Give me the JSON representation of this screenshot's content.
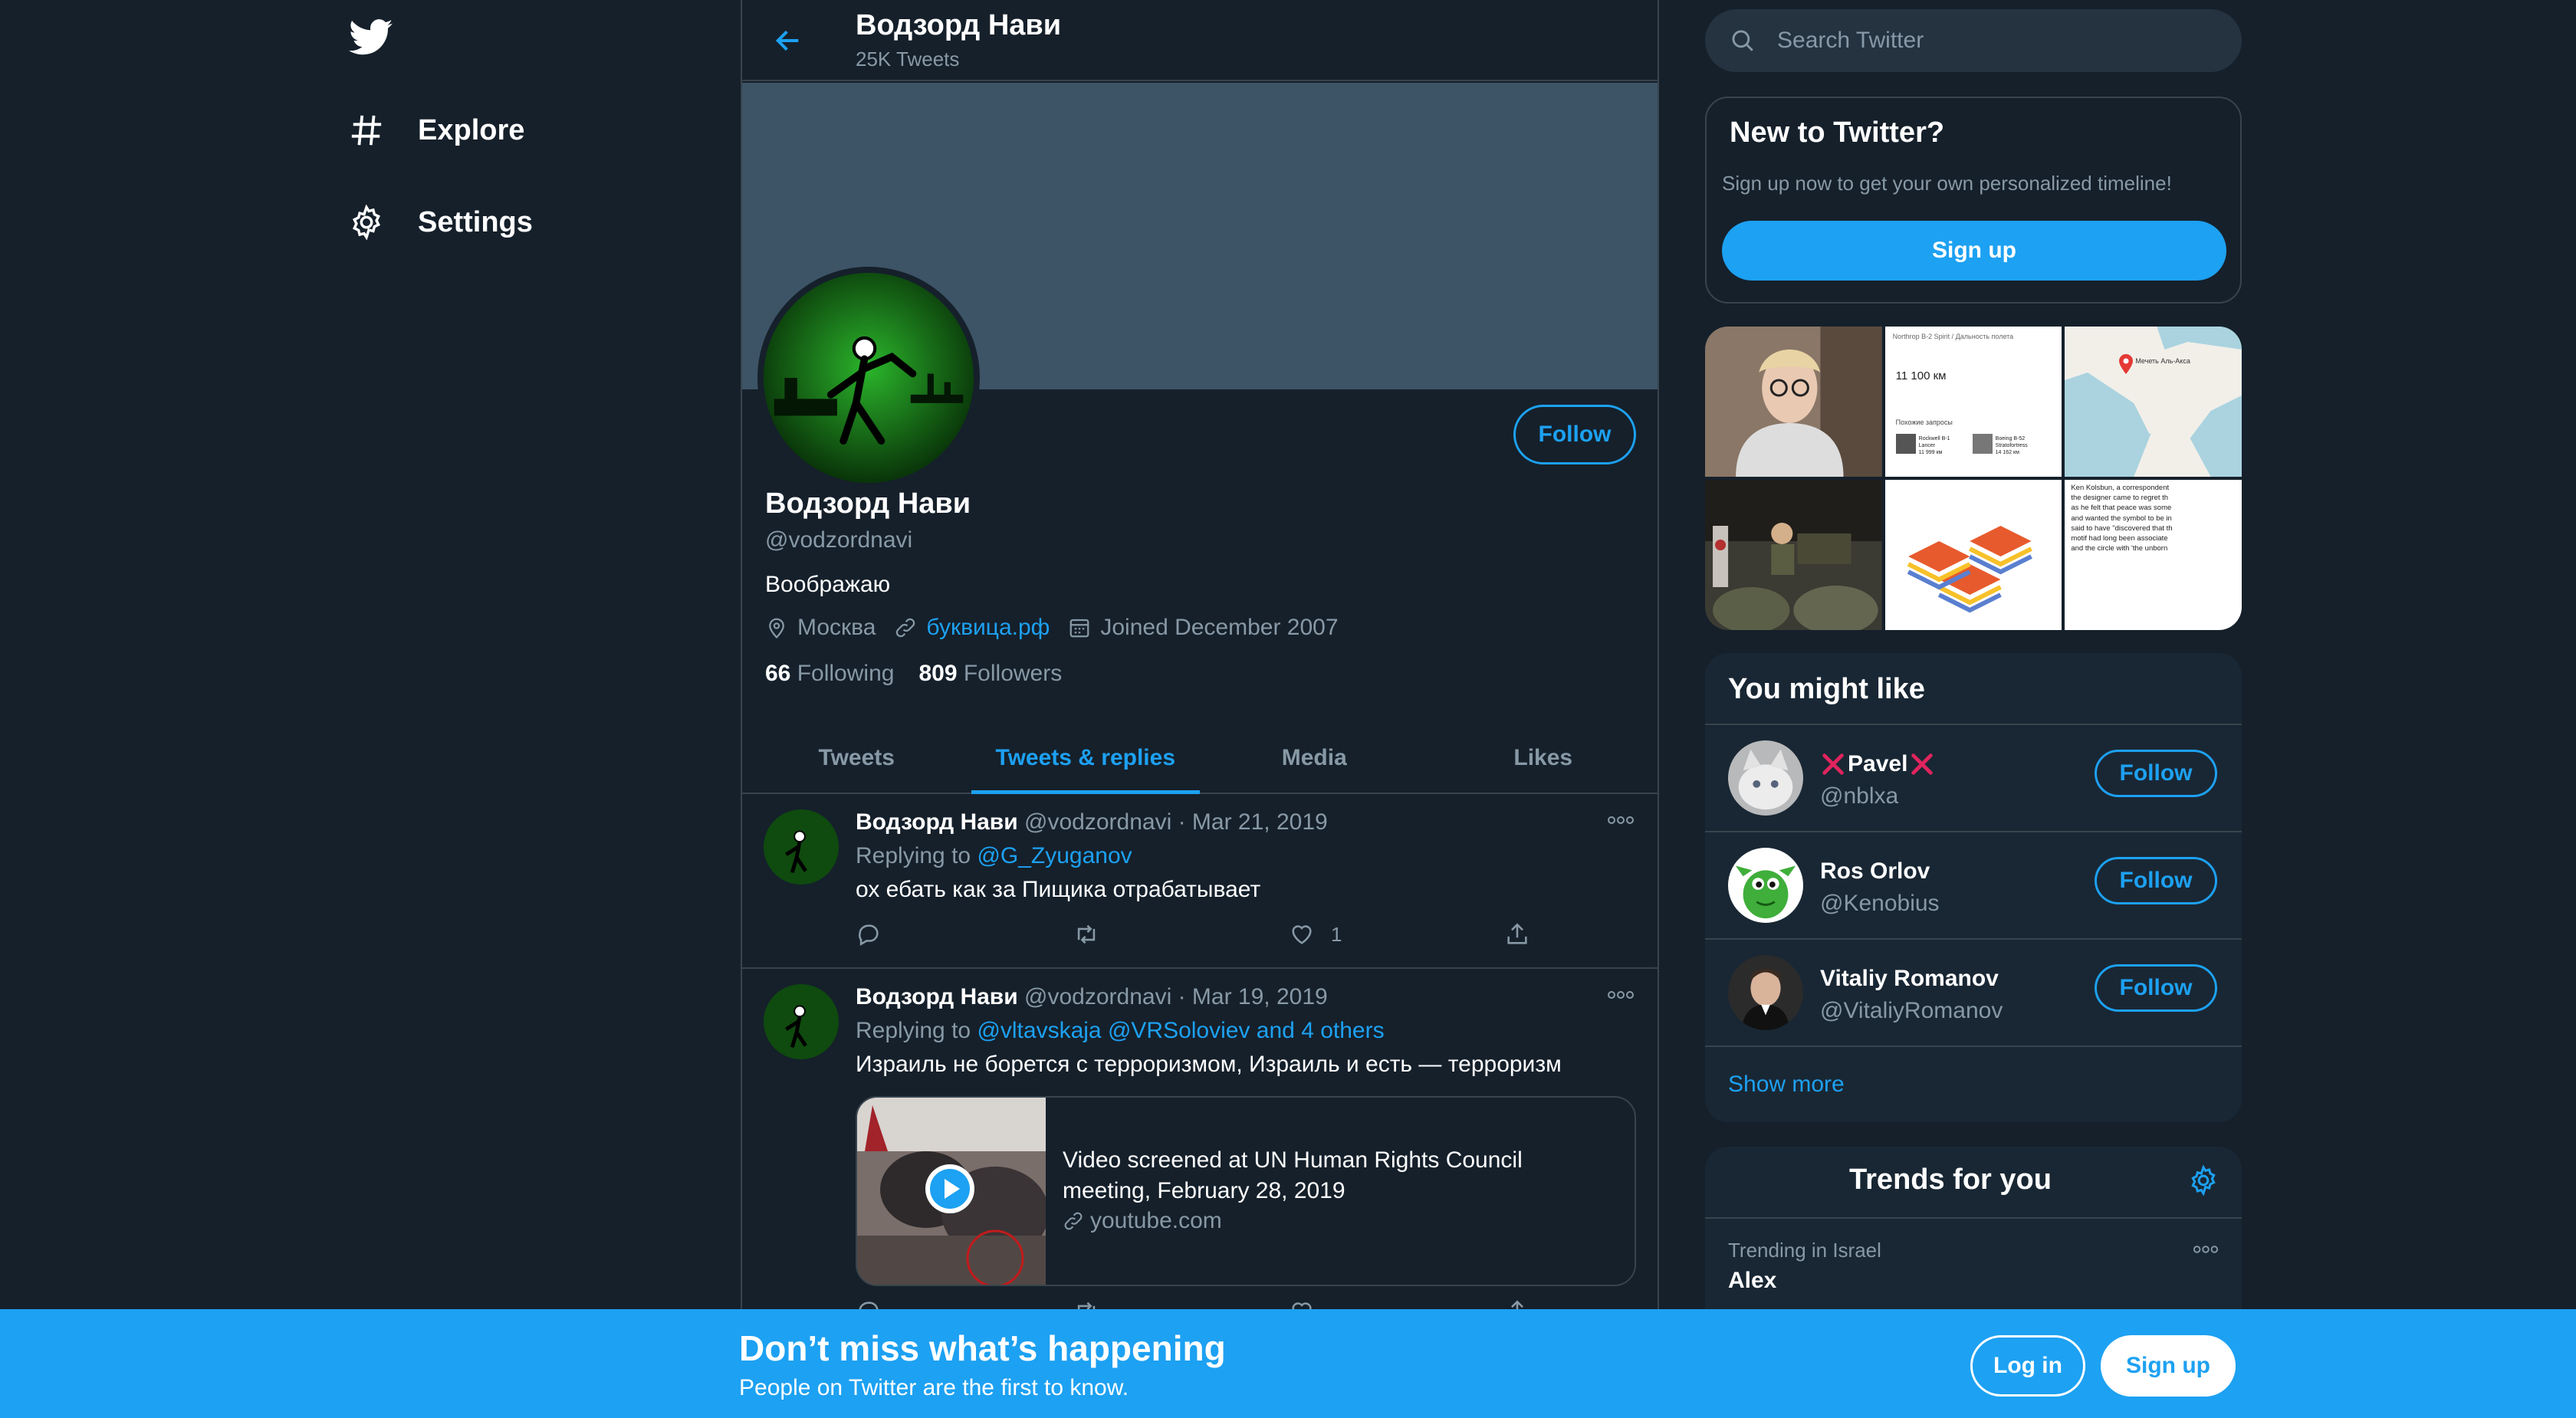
{
  "nav": {
    "logo_icon": "twitter-bird-icon",
    "items": [
      {
        "label": "Explore",
        "icon": "hashtag-icon"
      },
      {
        "label": "Settings",
        "icon": "gear-icon"
      }
    ]
  },
  "header": {
    "name": "Водзорд Нави",
    "tweets_count": "25K Tweets"
  },
  "profile": {
    "name": "Водзорд Нави",
    "handle": "@vodzordnavi",
    "bio": "Воображаю",
    "location": "Москва",
    "website": "буквица.рф",
    "joined": "Joined December 2007",
    "following_count": "66",
    "following_label": "Following",
    "followers_count": "809",
    "followers_label": "Followers",
    "follow_label": "Follow"
  },
  "tabs": [
    {
      "label": "Tweets",
      "active": false
    },
    {
      "label": "Tweets & replies",
      "active": true
    },
    {
      "label": "Media",
      "active": false
    },
    {
      "label": "Likes",
      "active": false
    }
  ],
  "tweets": [
    {
      "name": "Водзорд Нави",
      "handle": "@vodzordnavi",
      "date": "· Mar 21, 2019",
      "replying_prefix": "Replying to",
      "replying_to": "@G_Zyuganov",
      "text": "ох ебать как за Пищика отрабатывает",
      "likes": "1"
    },
    {
      "name": "Водзорд Нави",
      "handle": "@vodzordnavi",
      "date": "· Mar 19, 2019",
      "replying_prefix": "Replying to",
      "replying_to": "@vltavskaja @VRSoloviev and 4 others",
      "text": "Израиль не борется с терроризмом, Израиль и есть — терроризм",
      "card": {
        "title": "Video screened at UN Human Rights Council meeting, February 28, 2019",
        "url": "youtube.com"
      }
    }
  ],
  "search": {
    "placeholder": "Search Twitter"
  },
  "new_to_twitter": {
    "title": "New to Twitter?",
    "subtitle": "Sign up now to get your own personalized timeline!",
    "button": "Sign up"
  },
  "media_grid": {
    "tile2_header": "Northrop B-2 Spirit / Дальность полета",
    "tile2_value": "11 100 км",
    "tile2_related": "Похожие запросы",
    "tile2_item1": "Rockwell B-1 Lancer",
    "tile2_item1_val": "11 999 км",
    "tile2_item2": "Boeing B-52 Stratofortress",
    "tile2_item2_val": "14 162 км",
    "tile3_pin": "Мечеть Аль-Акса",
    "tile6_lines": [
      "Ken Kolsbun, a correspondent",
      "the designer came to regret th",
      "as he felt that peace was some",
      "and wanted the symbol to be in",
      "said to have \"discovered that th",
      "motif had long been associate",
      "and the circle with 'the unborn"
    ]
  },
  "who_to_follow": {
    "title": "You might like",
    "users": [
      {
        "name": "Pavel",
        "handle": "@nblxa",
        "follow": "Follow"
      },
      {
        "name": "Ros Orlov",
        "handle": "@Kenobius",
        "follow": "Follow"
      },
      {
        "name": "Vitaliy Romanov",
        "handle": "@VitaliyRomanov",
        "follow": "Follow"
      }
    ],
    "show_more": "Show more"
  },
  "trends": {
    "title": "Trends for you",
    "items": [
      {
        "context": "Trending in Israel",
        "name": "Alex"
      }
    ]
  },
  "bottom_bar": {
    "headline": "Don’t miss what’s happening",
    "sub": "People on Twitter are the first to know.",
    "login": "Log in",
    "signup": "Sign up"
  },
  "colors": {
    "background": "#15202b",
    "card": "#192734",
    "border": "#38444d",
    "accent": "#1da1f2",
    "muted": "#8899a6"
  }
}
